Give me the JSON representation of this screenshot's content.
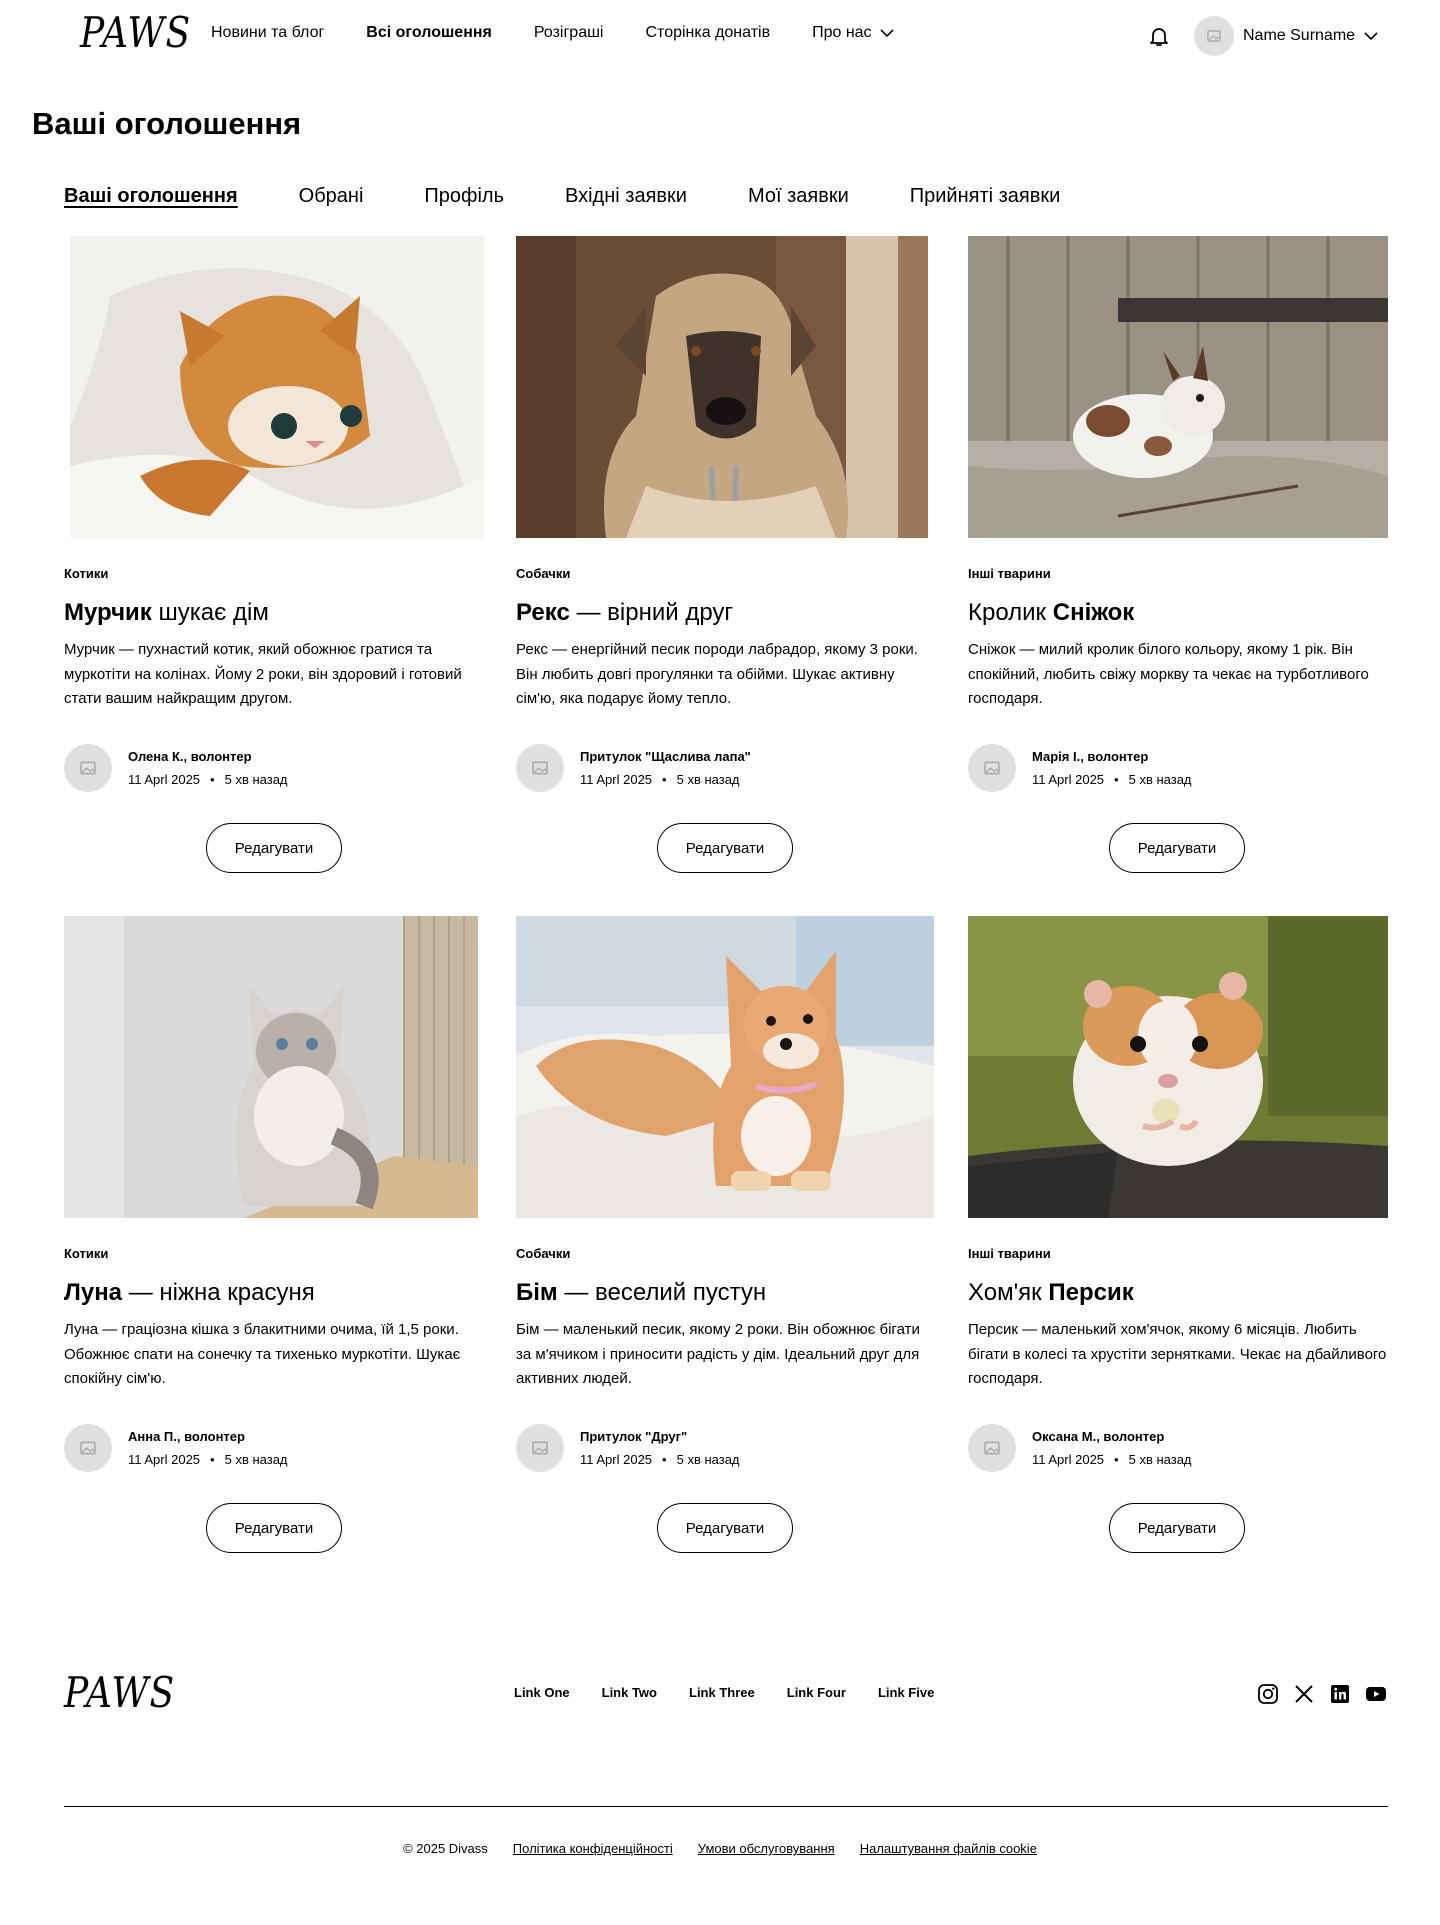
{
  "header": {
    "logo": "PAWS",
    "nav": [
      {
        "label": "Новини та блог",
        "active": false
      },
      {
        "label": "Всі оголошення",
        "active": true
      },
      {
        "label": "Розіграші",
        "active": false
      },
      {
        "label": "Сторінка донатів",
        "active": false
      },
      {
        "label": "Про нас",
        "active": false,
        "dropdown": true
      }
    ],
    "bell_icon": "bell-icon",
    "user_name": "Name Surname"
  },
  "page_title": "Ваші оголошення",
  "tabs": [
    {
      "label": "Ваші оголошення",
      "active": true
    },
    {
      "label": "Обрані",
      "active": false
    },
    {
      "label": "Профіль",
      "active": false
    },
    {
      "label": "Вхідні заявки",
      "active": false
    },
    {
      "label": "Мої заявки",
      "active": false
    },
    {
      "label": "Прийняті заявки",
      "active": false
    }
  ],
  "cards": [
    {
      "image": "orange-cat-photo",
      "category": "Котики",
      "title_bold": "Мурчик",
      "title_rest": " шукає дім",
      "description": "Мурчик — пухнастий котик, який обожнює гратися та муркотіти на колінах. Йому 2 роки, він здоровий і готовий стати вашим найкращим другом.",
      "author": "Олена К., волонтер",
      "date": "11 Aprl 2025",
      "ago": "5 хв назад",
      "button": "Редагувати"
    },
    {
      "image": "shepherd-dog-photo",
      "category": "Собачки",
      "title_bold": "Рекс",
      "title_rest": " — вірний друг",
      "description": "Рекс — енергійний песик породи лабрадор, якому 3 роки. Він любить довгі прогулянки та обійми. Шукає активну сім'ю, яка подарує йому тепло.",
      "author": "Притулок \"Щаслива лапа\"",
      "date": "11 Aprl 2025",
      "ago": "5 хв назад",
      "button": "Редагувати"
    },
    {
      "image": "white-rabbit-photo",
      "category": "Інші тварини",
      "title_prefix": "Кролик ",
      "title_bold": "Сніжок",
      "title_rest": "",
      "description": "Сніжок — милий кролик білого кольору, якому 1 рік. Він спокійний, любить свіжу моркву та чекає на турботливого господаря.",
      "author": "Марія І., волонтер",
      "date": "11 Aprl 2025",
      "ago": "5 хв назад",
      "button": "Редагувати"
    },
    {
      "image": "fluffy-cat-photo",
      "category": "Котики",
      "title_bold": "Луна",
      "title_rest": " — ніжна красуня",
      "description": "Луна — граціозна кішка з блакитними очима, їй 1,5 роки. Обожнює спати на сонечку та тихенько муркотіти. Шукає спокійну сім'ю.",
      "author": "Анна П., волонтер",
      "date": "11 Aprl 2025",
      "ago": "5 хв назад",
      "button": "Редагувати"
    },
    {
      "image": "shiba-puppy-photo",
      "category": "Собачки",
      "title_bold": "Бім",
      "title_rest": " — веселий пустун",
      "description": "Бім — маленький песик, якому 2 роки. Він обожнює бігати за м'ячиком і приносити радість у дім. Ідеальний друг для активних людей.",
      "author": "Притулок \"Друг\"",
      "date": "11 Aprl 2025",
      "ago": "5 хв назад",
      "button": "Редагувати"
    },
    {
      "image": "hamster-photo",
      "category": "Інші тварини",
      "title_prefix": "Хом'як ",
      "title_bold": "Персик",
      "title_rest": "",
      "description": "Персик — маленький хом'ячок, якому 6 місяців. Любить бігати в колесі та хрустіти зернятками. Чекає на дбайливого господаря.",
      "author": "Оксана М., волонтер",
      "date": "11 Aprl 2025",
      "ago": "5 хв назад",
      "button": "Редагувати"
    }
  ],
  "footer": {
    "logo": "PAWS",
    "links": [
      "Link One",
      "Link Two",
      "Link Three",
      "Link Four",
      "Link Five"
    ],
    "socials": [
      "instagram-icon",
      "x-icon",
      "linkedin-icon",
      "youtube-icon"
    ],
    "copyright": "© 2025 Divass",
    "legal": [
      "Політика конфіденційності",
      "Умови обслуговування",
      "Налаштування файлів cookie"
    ]
  }
}
